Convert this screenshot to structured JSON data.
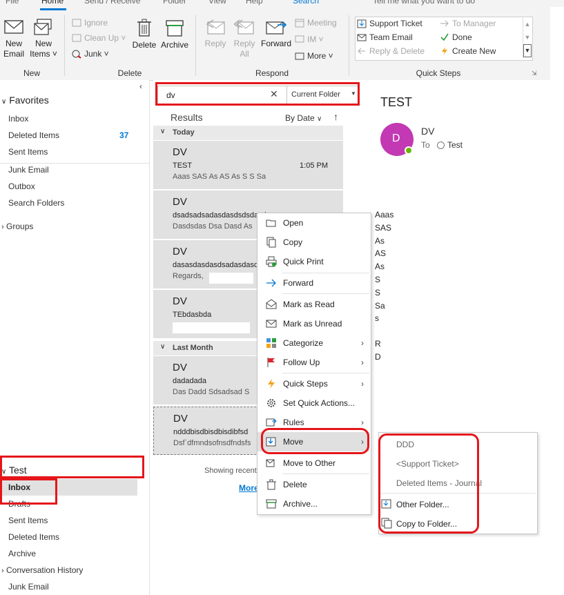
{
  "ribbon": {
    "top_tabs": [
      "File",
      "Home",
      "Send / Receive",
      "Folder",
      "View",
      "Help",
      "Search",
      "Tell me what you want to do"
    ],
    "new_email": "New\nEmail",
    "new_items": "New\nItems ˅",
    "new_group": "New",
    "ignore": "Ignore",
    "cleanup": "Clean Up ˅",
    "junk": "Junk ˅",
    "delete": "Delete",
    "archive": "Archive",
    "delete_group": "Delete",
    "reply": "Reply",
    "reply_all": "Reply\nAll",
    "forward": "Forward",
    "meeting": "Meeting",
    "im": "IM ˅",
    "more": "More ˅",
    "respond_group": "Respond",
    "qs_support_ticket": "Support Ticket",
    "qs_team_email": "Team Email",
    "qs_reply_delete": "Reply & Delete",
    "qs_to_manager": "To Manager",
    "qs_done": "Done",
    "qs_create_new": "Create New",
    "quick_steps_group": "Quick Steps"
  },
  "nav": {
    "favorites": "Favorites",
    "inbox": "Inbox",
    "deleted_items": "Deleted Items",
    "deleted_count": "37",
    "sent_items": "Sent Items",
    "junk_email": "Junk Email",
    "outbox": "Outbox",
    "search_folders": "Search Folders",
    "groups": "Groups",
    "test_account": "Test",
    "test_inbox": "Inbox",
    "test_drafts": "Drafts",
    "test_sent": "Sent Items",
    "test_deleted": "Deleted Items",
    "test_archive": "Archive",
    "test_conv_history": "Conversation History",
    "test_junk": "Junk Email"
  },
  "search": {
    "value": "dv",
    "scope": "Current Folder"
  },
  "list": {
    "results": "Results",
    "sort": "By Date",
    "today": "Today",
    "last_month": "Last Month",
    "showing": "Showing recent results...",
    "more": "More",
    "messages": [
      {
        "from": "DV",
        "subject": "TEST",
        "preview": "Aaas SAS As AS As S S Sa",
        "time": "1:05 PM"
      },
      {
        "from": "DV",
        "subject": "dsadsadsadasdasdsdsdasd",
        "preview": "Dasdsdas Dsa Dasd As",
        "time": ""
      },
      {
        "from": "DV",
        "subject": "dasasdasdasdsadasdasdasd",
        "preview": "Regards,",
        "time": ""
      },
      {
        "from": "DV",
        "subject": "TEbdasbda",
        "preview": "",
        "time": ""
      },
      {
        "from": "DV",
        "subject": "dadadada",
        "preview": "Das Dadd Sdsadsad S",
        "time": ""
      },
      {
        "from": "DV",
        "subject": "ndddbisdbisdbisdibfsd",
        "preview": "Dsf`dfmndsofnsdfndsfs",
        "time": ""
      }
    ]
  },
  "reading": {
    "title": "TEST",
    "avatar_letter": "D",
    "sender": "DV",
    "to_label": "To",
    "to_value": "Test",
    "body_lines": [
      "Aaas",
      "SAS",
      "As",
      "AS",
      "As",
      "S",
      "S",
      "Sa",
      "s",
      "",
      "R",
      "D"
    ]
  },
  "context_menu": {
    "open": "Open",
    "copy": "Copy",
    "quick_print": "Quick Print",
    "forward": "Forward",
    "mark_read": "Mark as Read",
    "mark_unread": "Mark as Unread",
    "categorize": "Categorize",
    "follow_up": "Follow Up",
    "quick_steps": "Quick Steps",
    "set_quick_actions": "Set Quick Actions...",
    "rules": "Rules",
    "move": "Move",
    "move_other": "Move to Other",
    "delete": "Delete",
    "archive": "Archive..."
  },
  "move_submenu": {
    "ddd": "DDD",
    "support_ticket": "<Support Ticket>",
    "deleted_journal": "Deleted Items - Journal",
    "other_folder": "Other Folder...",
    "copy_to_folder": "Copy to Folder..."
  },
  "colors": {
    "accent": "#0078d4",
    "highlight_red": "#e4161a",
    "avatar": "#c239b3",
    "message_bg": "#e1e1e1"
  }
}
